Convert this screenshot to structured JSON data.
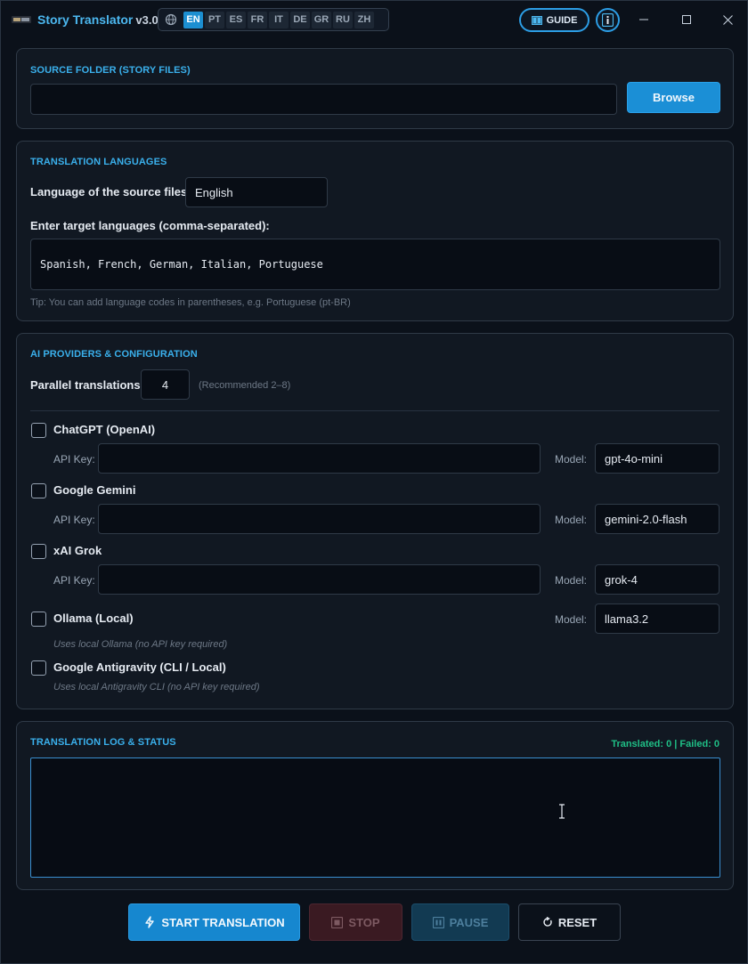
{
  "app": {
    "title": "Story Translator",
    "version": "v3.0"
  },
  "ui_languages": [
    "EN",
    "PT",
    "ES",
    "FR",
    "IT",
    "DE",
    "GR",
    "RU",
    "ZH"
  ],
  "ui_language_selected": "EN",
  "header": {
    "guide_label": "GUIDE"
  },
  "source": {
    "title": "SOURCE FOLDER (STORY FILES)",
    "path_value": "",
    "browse_label": "Browse"
  },
  "languages": {
    "title": "TRANSLATION LANGUAGES",
    "source_label": "Language of the source files:",
    "source_value": "English",
    "target_label": "Enter target languages (comma-separated):",
    "target_value": "Spanish, French, German, Italian, Portuguese",
    "tip": "Tip: You can add language codes in parentheses, e.g. Portuguese (pt-BR)"
  },
  "providers": {
    "title": "AI PROVIDERS & CONFIGURATION",
    "parallel_label": "Parallel translations:",
    "parallel_value": "4",
    "parallel_hint": "(Recommended 2–8)",
    "api_key_label": "API Key:",
    "model_label": "Model:",
    "items": [
      {
        "name": "ChatGPT (OpenAI)",
        "checked": false,
        "api_key": "",
        "model": "gpt-4o-mini"
      },
      {
        "name": "Google Gemini",
        "checked": false,
        "api_key": "",
        "model": "gemini-2.0-flash"
      },
      {
        "name": "xAI Grok",
        "checked": false,
        "api_key": "",
        "model": "grok-4"
      },
      {
        "name": "Ollama (Local)",
        "checked": false,
        "model": "llama3.2",
        "note": "Uses local Ollama (no API key required)"
      },
      {
        "name": "Google Antigravity (CLI / Local)",
        "checked": false,
        "note": "Uses local Antigravity CLI (no API key required)"
      }
    ]
  },
  "log": {
    "title": "TRANSLATION LOG & STATUS",
    "status": "Translated: 0 | Failed: 0",
    "content": ""
  },
  "actions": {
    "start": "START TRANSLATION",
    "stop": "STOP",
    "pause": "PAUSE",
    "reset": "RESET"
  },
  "colors": {
    "accent": "#1b8fd6",
    "title_blue": "#3ab0ec",
    "success_green": "#1fbf86",
    "background": "#0b111a"
  }
}
